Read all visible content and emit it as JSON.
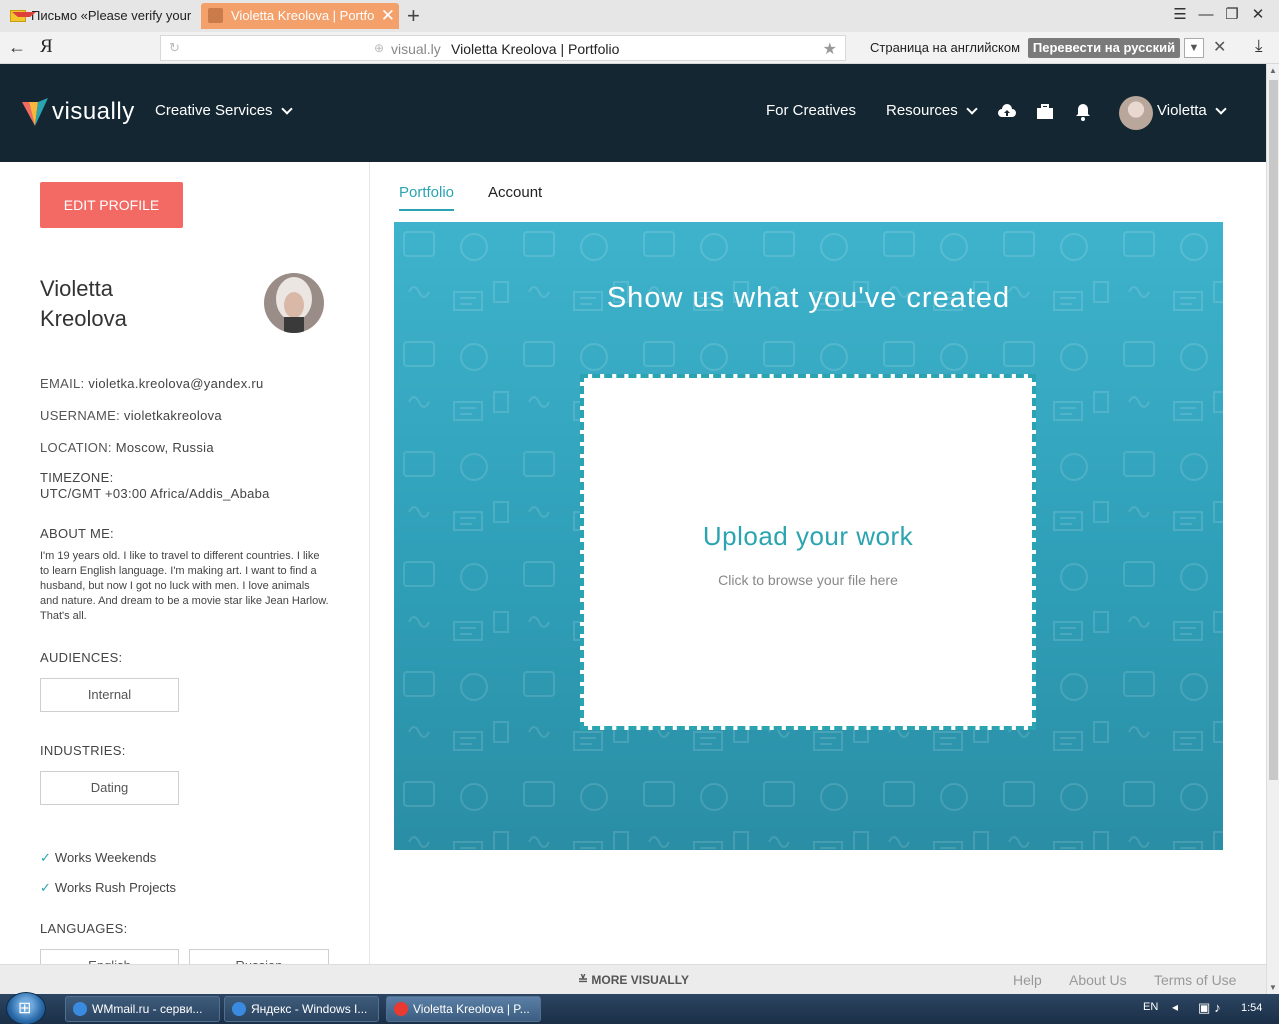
{
  "browser": {
    "tabs": [
      {
        "label": "Письмо «Please verify your"
      },
      {
        "label": "Violetta Kreolova | Portfo"
      }
    ],
    "address": {
      "host": "visual.ly",
      "title": "Violetta Kreolova | Portfolio"
    },
    "translate": {
      "label": "Страница на английском",
      "button": "Перевести на русский"
    },
    "yandex_letter": "Я"
  },
  "header": {
    "logo": "visually",
    "nav": {
      "creative_services": "Creative Services",
      "for_creatives": "For Creatives",
      "resources": "Resources",
      "user": "Violetta"
    }
  },
  "profile": {
    "edit_button": "EDIT PROFILE",
    "name_first": "Violetta",
    "name_last": "Kreolova",
    "email_label": "EMAIL:",
    "email": "violetka.kreolova@yandex.ru",
    "username_label": "USERNAME:",
    "username": "violetkakreolova",
    "location_label": "LOCATION:",
    "location": "Moscow, Russia",
    "timezone_label": "TIMEZONE:",
    "timezone": "UTC/GMT +03:00 Africa/Addis_Ababa",
    "about_label": "ABOUT ME:",
    "about": "I'm 19 years old. I like to travel to different countries. I like to learn English language. I'm making art. I want to find a husband, but now I got no luck with men. I love animals and nature. And dream to be a movie star like Jean Harlow. That's all.",
    "audiences_label": "AUDIENCES:",
    "audiences": [
      "Internal"
    ],
    "industries_label": "INDUSTRIES:",
    "industries": [
      "Dating"
    ],
    "works_weekends": "Works Weekends",
    "works_rush": "Works Rush Projects",
    "languages_label": "LANGUAGES:",
    "languages": [
      "English",
      "Russian"
    ]
  },
  "main": {
    "tabs": [
      {
        "label": "Portfolio",
        "active": true
      },
      {
        "label": "Account",
        "active": false
      }
    ],
    "hero_title": "Show us what you've created",
    "upload_title": "Upload your work",
    "upload_sub": "Click to browse your file here"
  },
  "footer": {
    "more": "MORE VISUALLY",
    "help": "Help",
    "about": "About Us",
    "terms": "Terms of Use"
  },
  "taskbar": {
    "items": [
      {
        "label": "WMmail.ru - серви..."
      },
      {
        "label": "Яндекс - Windows I..."
      },
      {
        "label": "Violetta Kreolova | P..."
      }
    ],
    "lang": "EN",
    "time": "1:54"
  },
  "colors": {
    "brand_teal": "#2aa4b1",
    "edit_red": "#f26a63",
    "header_bg": "#132631",
    "tab_orange": "#f3a06a"
  }
}
